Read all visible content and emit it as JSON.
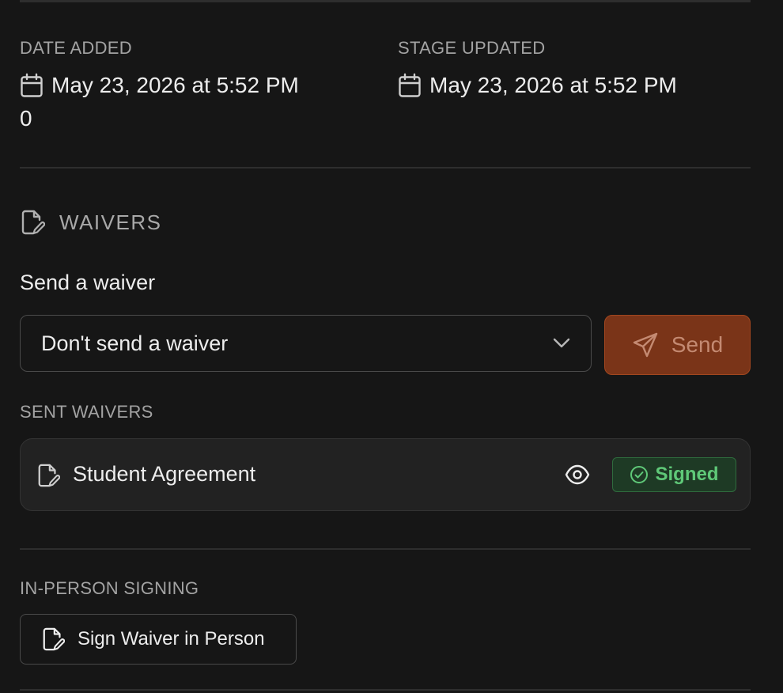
{
  "meta": {
    "date_added_label": "DATE ADDED",
    "date_added_value": "May 23, 2026 at 5:52 PM",
    "date_added_extra": "0",
    "stage_updated_label": "STAGE UPDATED",
    "stage_updated_value": "May 23, 2026 at 5:52 PM"
  },
  "waivers": {
    "section_title": "WAIVERS",
    "send_label": "Send a waiver",
    "select_value": "Don't send a waiver",
    "send_button": "Send",
    "sent_label": "SENT WAIVERS",
    "sent": [
      {
        "name": "Student Agreement",
        "status": "Signed"
      }
    ],
    "in_person_label": "IN-PERSON SIGNING",
    "in_person_button": "Sign Waiver in Person"
  },
  "colors": {
    "background": "#161616",
    "accent": "#7a3418",
    "signed_green": "#5fc878"
  }
}
